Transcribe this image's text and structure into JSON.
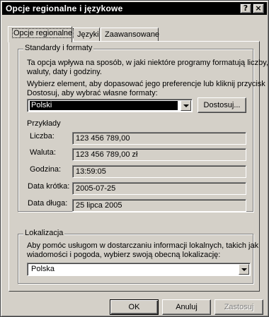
{
  "window": {
    "title": "Opcje regionalne i językowe",
    "help_label": "?",
    "close_label": "×"
  },
  "tabs": [
    {
      "label": "Opcje regionalne",
      "active": true
    },
    {
      "label": "Języki",
      "active": false
    },
    {
      "label": "Zaawansowane",
      "active": false
    }
  ],
  "standards": {
    "group_title": "Standardy i formaty",
    "desc_line1": "Ta opcja wpływa na sposób, w jaki niektóre programy formatują liczby,",
    "desc_line2": "waluty, daty i godziny.",
    "instr_line1": "Wybierz element, aby dopasować jego preferencje lub kliknij przycisk",
    "instr_line2": "Dostosuj, aby wybrać własne formaty:",
    "selected_format": "Polski",
    "customize_label": "Dostosuj..."
  },
  "examples": {
    "title": "Przykłady",
    "rows": [
      {
        "label": "Liczba:",
        "value": "123 456 789,00"
      },
      {
        "label": "Waluta:",
        "value": "123 456 789,00 zł"
      },
      {
        "label": "Godzina:",
        "value": "13:59:05"
      },
      {
        "label": "Data krótka:",
        "value": "2005-07-25"
      },
      {
        "label": "Data długa:",
        "value": "25 lipca 2005"
      }
    ]
  },
  "location": {
    "group_title": "Lokalizacja",
    "desc_line1": "Aby pomóc usługom w dostarczaniu informacji lokalnych, takich jak",
    "desc_line2": "wiadomości i pogoda, wybierz swoją obecną lokalizację:",
    "selected_location": "Polska"
  },
  "footer": {
    "ok_label": "OK",
    "cancel_label": "Anuluj",
    "apply_label": "Zastosuj"
  }
}
